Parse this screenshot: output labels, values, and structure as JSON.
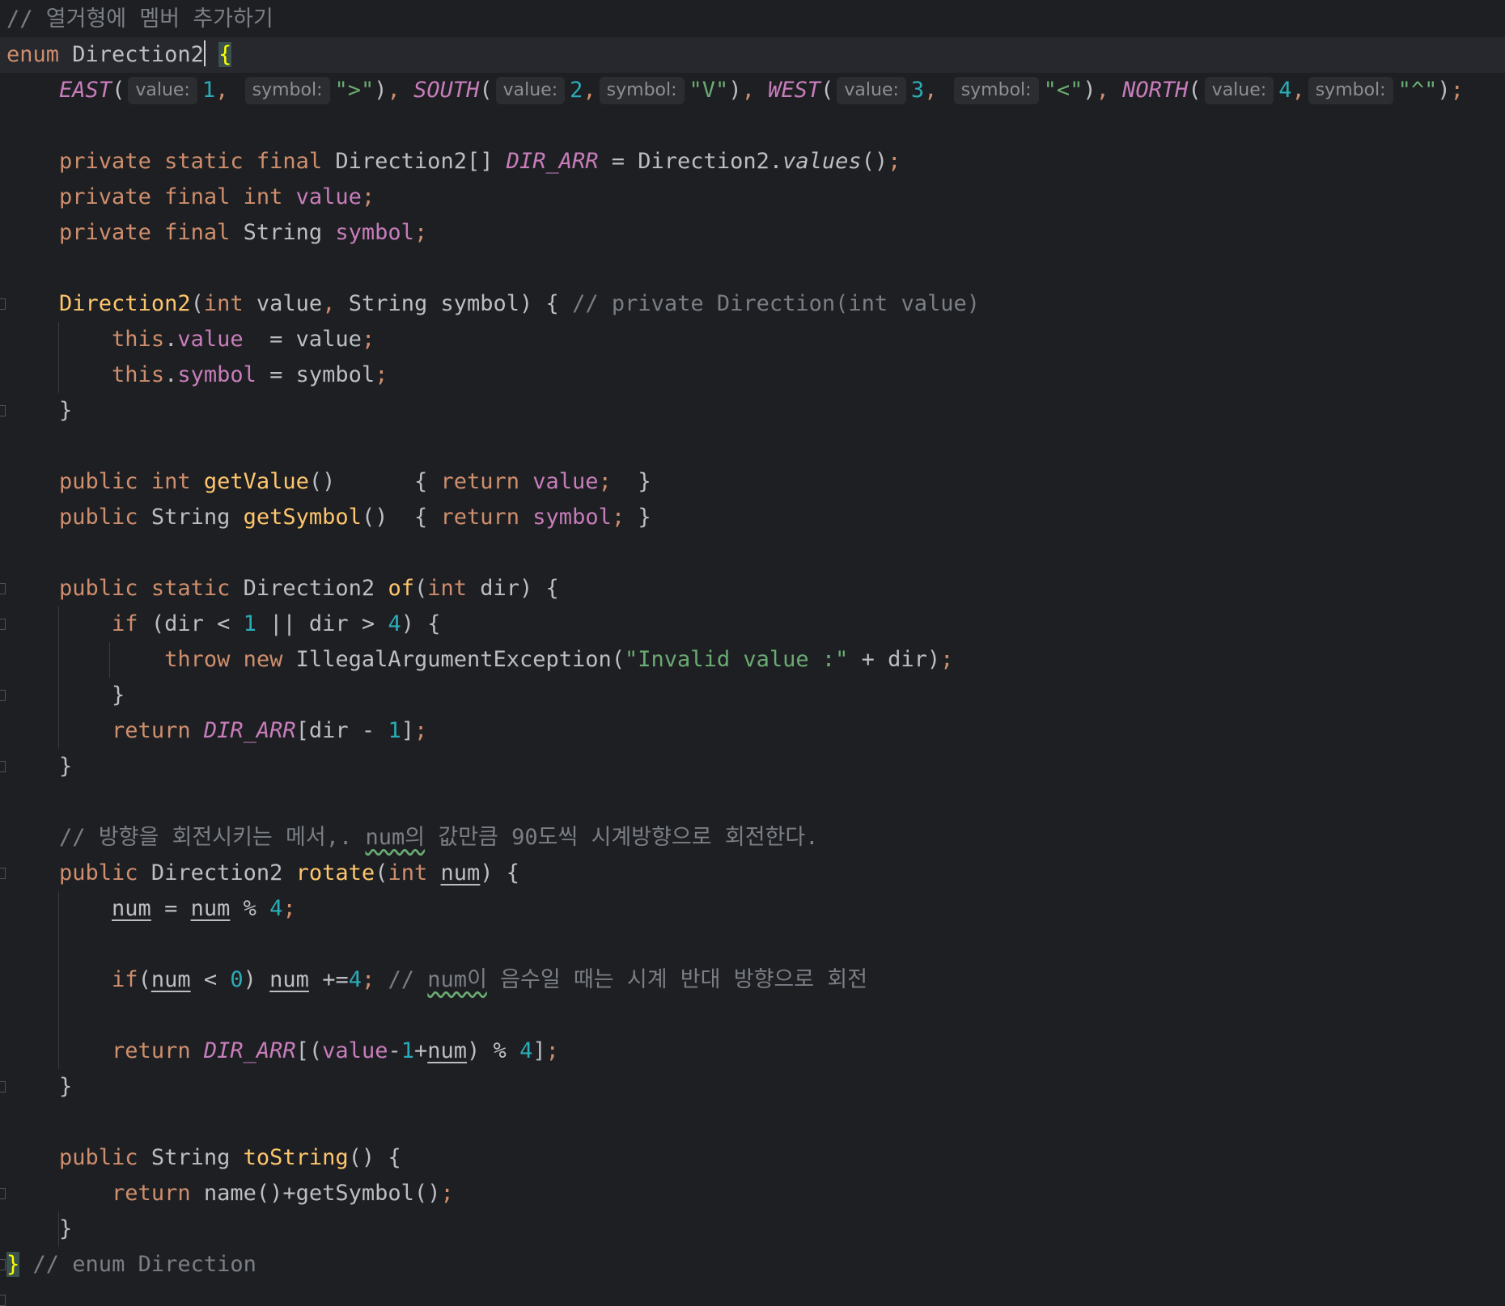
{
  "editor": {
    "theme": {
      "background": "#1e1f22",
      "keyword": "#cf8e6d",
      "comment": "#7a7e85",
      "string": "#6aab73",
      "number": "#2aacb8",
      "field": "#c77dbb",
      "method_decl": "#ffc66d"
    },
    "lines": [
      [
        {
          "t": "// 열거형에 멤버 추가하기",
          "c": "cmt"
        }
      ],
      [
        {
          "t": "enum",
          "c": "kw"
        },
        {
          "t": " Direction2"
        },
        {
          "t": "",
          "c": "caret"
        },
        {
          "t": " "
        },
        {
          "t": "{",
          "c": "brace-hl"
        }
      ],
      [
        {
          "t": "    "
        },
        {
          "t": "EAST",
          "c": "fld itl"
        },
        {
          "t": "("
        },
        {
          "t": "value:",
          "c": "hint"
        },
        {
          "t": "1",
          "c": "num"
        },
        {
          "t": ", ",
          "c": "kw"
        },
        {
          "t": "symbol:",
          "c": "hint"
        },
        {
          "t": "\">\"",
          "c": "str"
        },
        {
          "t": ")"
        },
        {
          "t": ", ",
          "c": "kw"
        },
        {
          "t": "SOUTH",
          "c": "fld itl"
        },
        {
          "t": "("
        },
        {
          "t": "value:",
          "c": "hint"
        },
        {
          "t": "2",
          "c": "num"
        },
        {
          "t": ",",
          "c": "kw"
        },
        {
          "t": "symbol:",
          "c": "hint"
        },
        {
          "t": "\"V\"",
          "c": "str"
        },
        {
          "t": ")"
        },
        {
          "t": ", ",
          "c": "kw"
        },
        {
          "t": "WEST",
          "c": "fld itl"
        },
        {
          "t": "("
        },
        {
          "t": "value:",
          "c": "hint"
        },
        {
          "t": "3",
          "c": "num"
        },
        {
          "t": ", ",
          "c": "kw"
        },
        {
          "t": "symbol:",
          "c": "hint"
        },
        {
          "t": "\"<\"",
          "c": "str"
        },
        {
          "t": ")"
        },
        {
          "t": ", ",
          "c": "kw"
        },
        {
          "t": "NORTH",
          "c": "fld itl"
        },
        {
          "t": "("
        },
        {
          "t": "value:",
          "c": "hint"
        },
        {
          "t": "4",
          "c": "num"
        },
        {
          "t": ",",
          "c": "kw"
        },
        {
          "t": "symbol:",
          "c": "hint"
        },
        {
          "t": "\"^\"",
          "c": "str"
        },
        {
          "t": ")"
        },
        {
          "t": ";",
          "c": "kw"
        }
      ],
      [],
      [
        {
          "t": "    "
        },
        {
          "t": "private static final",
          "c": "kw"
        },
        {
          "t": " Direction2[] "
        },
        {
          "t": "DIR_ARR",
          "c": "fld itl"
        },
        {
          "t": " = Direction2."
        },
        {
          "t": "values",
          "c": "itl"
        },
        {
          "t": "()"
        },
        {
          "t": ";",
          "c": "kw"
        }
      ],
      [
        {
          "t": "    "
        },
        {
          "t": "private final int",
          "c": "kw"
        },
        {
          "t": " "
        },
        {
          "t": "value",
          "c": "fld"
        },
        {
          "t": ";",
          "c": "kw"
        }
      ],
      [
        {
          "t": "    "
        },
        {
          "t": "private final",
          "c": "kw"
        },
        {
          "t": " String "
        },
        {
          "t": "symbol",
          "c": "fld"
        },
        {
          "t": ";",
          "c": "kw"
        }
      ],
      [],
      [
        {
          "t": "    "
        },
        {
          "t": "Direction2",
          "c": "decl"
        },
        {
          "t": "("
        },
        {
          "t": "int",
          "c": "kw"
        },
        {
          "t": " value"
        },
        {
          "t": ",",
          "c": "kw"
        },
        {
          "t": " String symbol) { "
        },
        {
          "t": "// private Direction(int value)",
          "c": "cmt"
        }
      ],
      [
        {
          "t": "        "
        },
        {
          "t": "this",
          "c": "kw"
        },
        {
          "t": "."
        },
        {
          "t": "value",
          "c": "fld"
        },
        {
          "t": "  = value"
        },
        {
          "t": ";",
          "c": "kw"
        }
      ],
      [
        {
          "t": "        "
        },
        {
          "t": "this",
          "c": "kw"
        },
        {
          "t": "."
        },
        {
          "t": "symbol",
          "c": "fld"
        },
        {
          "t": " = symbol"
        },
        {
          "t": ";",
          "c": "kw"
        }
      ],
      [
        {
          "t": "    }"
        }
      ],
      [],
      [
        {
          "t": "    "
        },
        {
          "t": "public int",
          "c": "kw"
        },
        {
          "t": " "
        },
        {
          "t": "getValue",
          "c": "decl"
        },
        {
          "t": "()      { "
        },
        {
          "t": "return",
          "c": "kw"
        },
        {
          "t": " "
        },
        {
          "t": "value",
          "c": "fld"
        },
        {
          "t": ";",
          "c": "kw"
        },
        {
          "t": "  }"
        }
      ],
      [
        {
          "t": "    "
        },
        {
          "t": "public",
          "c": "kw"
        },
        {
          "t": " String "
        },
        {
          "t": "getSymbol",
          "c": "decl"
        },
        {
          "t": "()  { "
        },
        {
          "t": "return",
          "c": "kw"
        },
        {
          "t": " "
        },
        {
          "t": "symbol",
          "c": "fld"
        },
        {
          "t": ";",
          "c": "kw"
        },
        {
          "t": " }"
        }
      ],
      [],
      [
        {
          "t": "    "
        },
        {
          "t": "public static",
          "c": "kw"
        },
        {
          "t": " Direction2 "
        },
        {
          "t": "of",
          "c": "decl"
        },
        {
          "t": "("
        },
        {
          "t": "int",
          "c": "kw"
        },
        {
          "t": " dir) {"
        }
      ],
      [
        {
          "t": "        "
        },
        {
          "t": "if",
          "c": "kw"
        },
        {
          "t": " (dir < "
        },
        {
          "t": "1",
          "c": "num"
        },
        {
          "t": " || dir > "
        },
        {
          "t": "4",
          "c": "num"
        },
        {
          "t": ") {"
        }
      ],
      [
        {
          "t": "            "
        },
        {
          "t": "throw new",
          "c": "kw"
        },
        {
          "t": " IllegalArgumentException("
        },
        {
          "t": "\"Invalid value :\"",
          "c": "str"
        },
        {
          "t": " + dir)"
        },
        {
          "t": ";",
          "c": "kw"
        }
      ],
      [
        {
          "t": "        }"
        }
      ],
      [
        {
          "t": "        "
        },
        {
          "t": "return",
          "c": "kw"
        },
        {
          "t": " "
        },
        {
          "t": "DIR_ARR",
          "c": "fld itl"
        },
        {
          "t": "[dir - "
        },
        {
          "t": "1",
          "c": "num"
        },
        {
          "t": "]"
        },
        {
          "t": ";",
          "c": "kw"
        }
      ],
      [
        {
          "t": "    }"
        }
      ],
      [],
      [
        {
          "t": "    "
        },
        {
          "t": "// 방향을 회전시키는 메서,. ",
          "c": "cmt"
        },
        {
          "t": "num의",
          "c": "cmt wavy"
        },
        {
          "t": " 값만큼 90도씩 시계방향으로 회전한다.",
          "c": "cmt"
        }
      ],
      [
        {
          "t": "    "
        },
        {
          "t": "public",
          "c": "kw"
        },
        {
          "t": " Direction2 "
        },
        {
          "t": "rotate",
          "c": "decl"
        },
        {
          "t": "("
        },
        {
          "t": "int",
          "c": "kw"
        },
        {
          "t": " "
        },
        {
          "t": "num",
          "c": "und"
        },
        {
          "t": ") {"
        }
      ],
      [
        {
          "t": "        "
        },
        {
          "t": "num",
          "c": "und"
        },
        {
          "t": " = "
        },
        {
          "t": "num",
          "c": "und"
        },
        {
          "t": " % "
        },
        {
          "t": "4",
          "c": "num"
        },
        {
          "t": ";",
          "c": "kw"
        }
      ],
      [],
      [
        {
          "t": "        "
        },
        {
          "t": "if",
          "c": "kw"
        },
        {
          "t": "("
        },
        {
          "t": "num",
          "c": "und"
        },
        {
          "t": " < "
        },
        {
          "t": "0",
          "c": "num"
        },
        {
          "t": ") "
        },
        {
          "t": "num",
          "c": "und"
        },
        {
          "t": " +="
        },
        {
          "t": "4",
          "c": "num"
        },
        {
          "t": ";",
          "c": "kw"
        },
        {
          "t": " // ",
          "c": "cmt"
        },
        {
          "t": "num이",
          "c": "cmt wavy"
        },
        {
          "t": " 음수일 때는 시계 반대 방향으로 회전",
          "c": "cmt"
        }
      ],
      [],
      [
        {
          "t": "        "
        },
        {
          "t": "return",
          "c": "kw"
        },
        {
          "t": " "
        },
        {
          "t": "DIR_ARR",
          "c": "fld itl"
        },
        {
          "t": "[("
        },
        {
          "t": "value",
          "c": "fld"
        },
        {
          "t": "-"
        },
        {
          "t": "1",
          "c": "num"
        },
        {
          "t": "+"
        },
        {
          "t": "num",
          "c": "und"
        },
        {
          "t": ") % "
        },
        {
          "t": "4",
          "c": "num"
        },
        {
          "t": "]"
        },
        {
          "t": ";",
          "c": "kw"
        }
      ],
      [
        {
          "t": "    }"
        }
      ],
      [],
      [
        {
          "t": "    "
        },
        {
          "t": "public",
          "c": "kw"
        },
        {
          "t": " String "
        },
        {
          "t": "toString",
          "c": "decl"
        },
        {
          "t": "() {"
        }
      ],
      [
        {
          "t": "        "
        },
        {
          "t": "return",
          "c": "kw"
        },
        {
          "t": " name()+getSymbol()"
        },
        {
          "t": ";",
          "c": "kw"
        }
      ],
      [
        {
          "t": "    }"
        }
      ],
      [
        {
          "t": "}",
          "c": "brace-hl"
        },
        {
          "t": " "
        },
        {
          "t": "// enum Direction",
          "c": "cmt"
        }
      ]
    ]
  }
}
